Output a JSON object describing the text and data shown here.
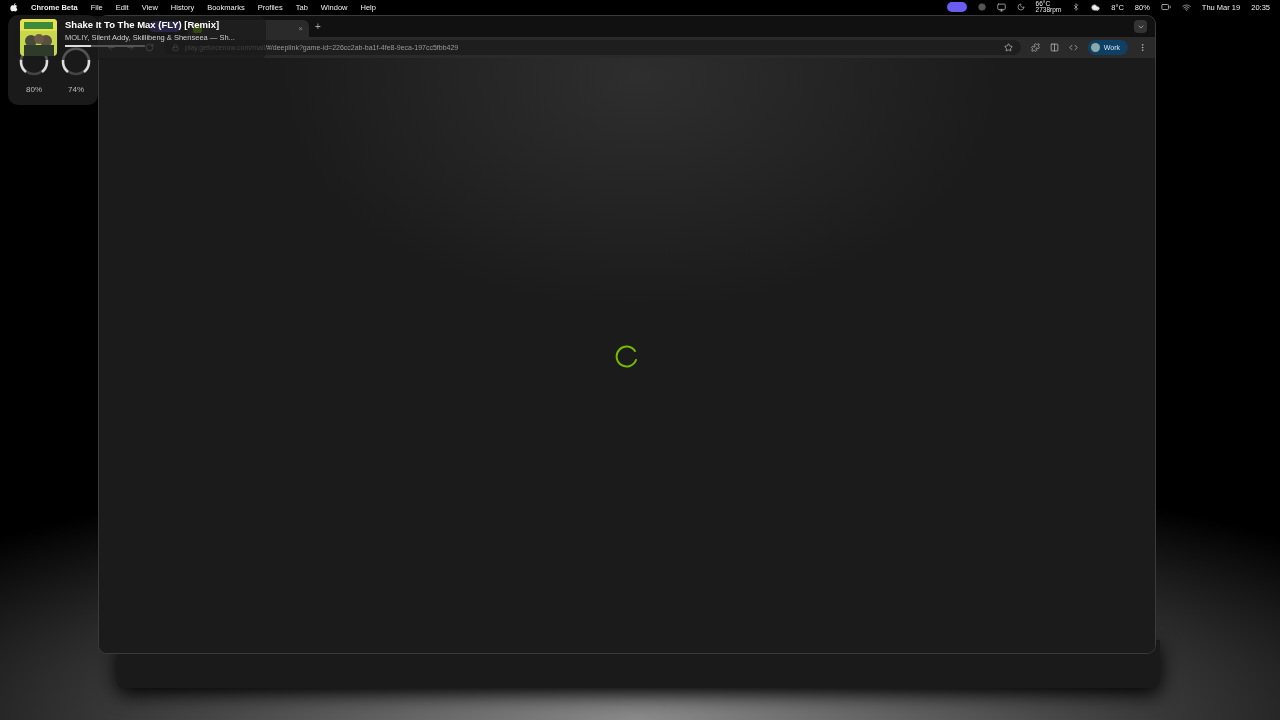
{
  "menu_bar": {
    "app": "Chrome Beta",
    "menus": [
      "File",
      "Edit",
      "View",
      "History",
      "Bookmarks",
      "Profiles",
      "Tab",
      "Window",
      "Help"
    ],
    "temperature": "66°C",
    "fan_speed": "2738rpm",
    "weather": "8°C",
    "battery": "80%",
    "date": "Thu Mar 19",
    "time": "20:35"
  },
  "now_playing": {
    "title": "Shake It To The Max (FLY) [Remix]",
    "artists": "MOLIY, Silent Addy, Skillibeng & Shenseea — Sh...",
    "level": 0.33,
    "gauges": [
      {
        "reading": "80%"
      },
      {
        "reading": "74%"
      }
    ]
  },
  "browser": {
    "tabs": [
      {
        "kind": "group"
      },
      {
        "kind": "page",
        "selected": true,
        "close": "×"
      }
    ],
    "new_tab": "+",
    "url": "play.geforcenow.com/mall/#/deeplink?game-id=226cc2ab-ba1f-4fe8-9eca-197cc5fbb429",
    "profile": "Work",
    "loading": true
  }
}
